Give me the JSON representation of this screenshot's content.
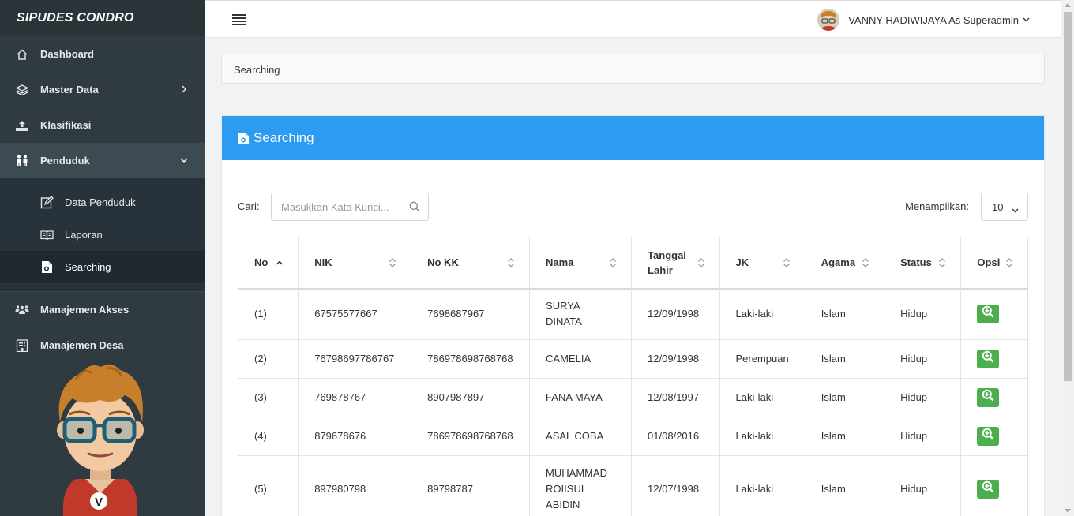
{
  "brand": "SIPUDES CONDRO",
  "sidebar": {
    "items": [
      {
        "label": "Dashboard",
        "icon": "home-icon"
      },
      {
        "label": "Master Data",
        "icon": "layers-icon"
      },
      {
        "label": "Klasifikasi",
        "icon": "upload-icon"
      },
      {
        "label": "Penduduk",
        "icon": "people-icon"
      },
      {
        "label": "Manajemen Akses",
        "icon": "users-icon"
      },
      {
        "label": "Manajemen Desa",
        "icon": "building-icon"
      }
    ],
    "sub_items": [
      {
        "label": "Data Penduduk",
        "icon": "edit-icon"
      },
      {
        "label": "Laporan",
        "icon": "book-icon"
      },
      {
        "label": "Searching",
        "icon": "file-search-icon"
      }
    ]
  },
  "header": {
    "user": "VANNY HADIWIJAYA As Superadmin"
  },
  "breadcrumb": "Searching",
  "card": {
    "title": "Searching",
    "search_label": "Cari:",
    "search_placeholder": "Masukkan Kata Kunci...",
    "show_label": "Menampilkan:",
    "show_value": "10"
  },
  "table": {
    "headers": [
      "No",
      "NIK",
      "No KK",
      "Nama",
      "Tanggal Lahir",
      "JK",
      "Agama",
      "Status",
      "Opsi"
    ],
    "rows": [
      {
        "no": "(1)",
        "nik": "67575577667",
        "kk": "7698687967",
        "nama": "SURYA DINATA",
        "tgl": "12/09/1998",
        "jk": "Laki-laki",
        "agama": "Islam",
        "status": "Hidup"
      },
      {
        "no": "(2)",
        "nik": "76798697786767",
        "kk": "786978698768768",
        "nama": "CAMELIA",
        "tgl": "12/09/1998",
        "jk": "Perempuan",
        "agama": "Islam",
        "status": "Hidup"
      },
      {
        "no": "(3)",
        "nik": "769878767",
        "kk": "8907987897",
        "nama": "FANA MAYA",
        "tgl": "12/08/1997",
        "jk": "Laki-laki",
        "agama": "Islam",
        "status": "Hidup"
      },
      {
        "no": "(4)",
        "nik": "879678676",
        "kk": "786978698768768",
        "nama": "ASAL COBA",
        "tgl": "01/08/2016",
        "jk": "Laki-laki",
        "agama": "Islam",
        "status": "Hidup"
      },
      {
        "no": "(5)",
        "nik": "897980798",
        "kk": "89798787",
        "nama": "MUHAMMAD ROIISUL ABIDIN",
        "tgl": "12/07/1998",
        "jk": "Laki-laki",
        "agama": "Islam",
        "status": "Hidup"
      }
    ]
  },
  "colors": {
    "sidebar": "#2f3b41",
    "accent": "#2d9bef",
    "zoom_button": "#4cae4c"
  }
}
